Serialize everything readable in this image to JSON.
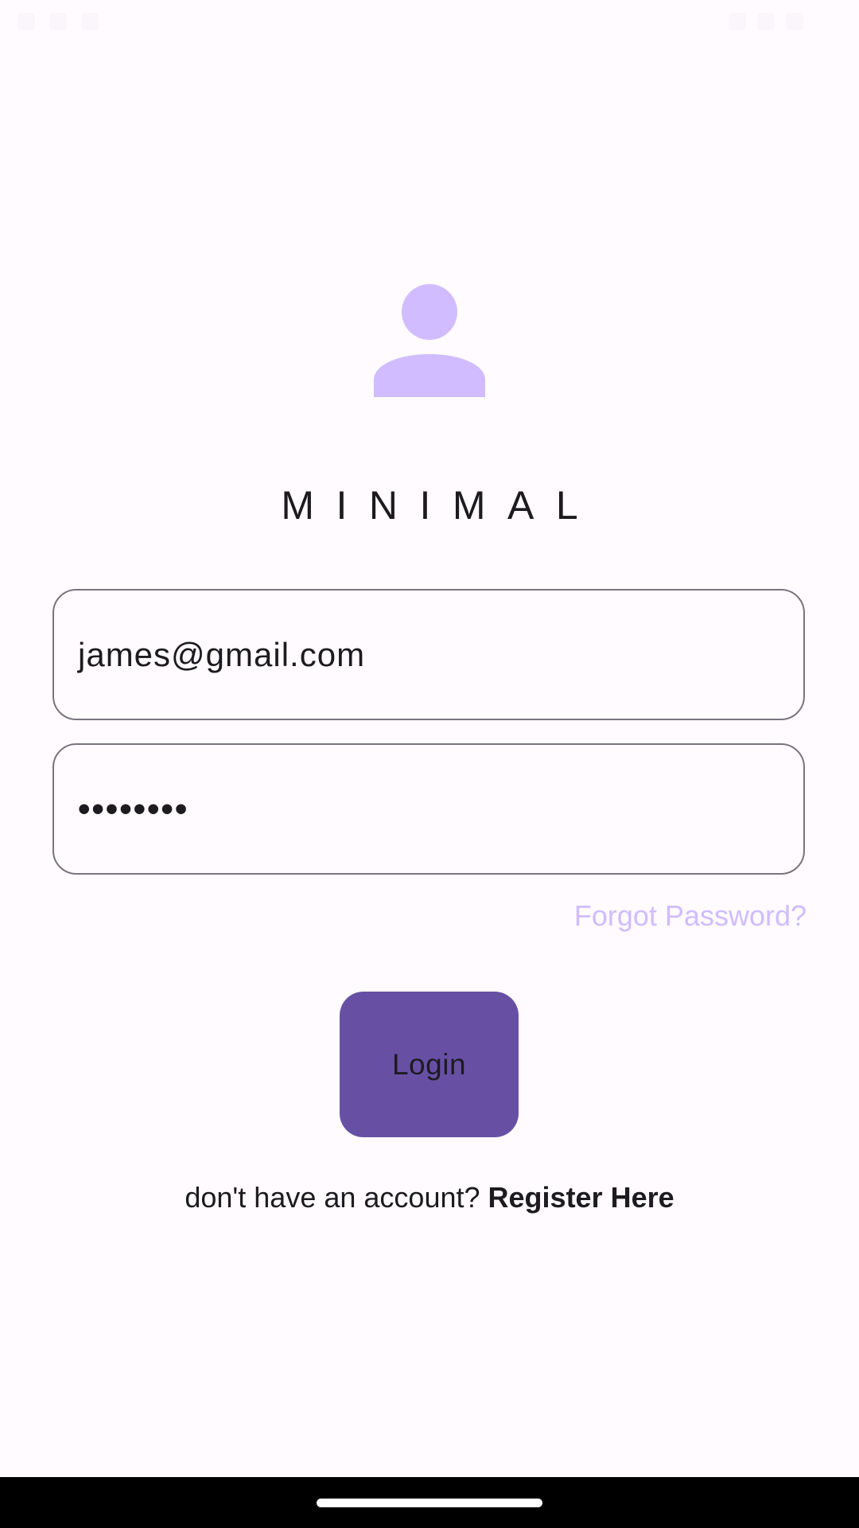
{
  "app": {
    "title": "MINIMAL"
  },
  "icons": {
    "avatar": "person-icon"
  },
  "login_form": {
    "email_value": "james@gmail.com",
    "password_value": "••••••••",
    "forgot_password_label": "Forgot Password?",
    "login_button_label": "Login"
  },
  "register": {
    "prompt": "don't have an account?",
    "link_label": "Register Here"
  },
  "colors": {
    "background": "#fffbfe",
    "primary": "#6750a4",
    "accent_light": "#d0bcff",
    "outline": "#79747e",
    "text": "#1d1b20"
  }
}
